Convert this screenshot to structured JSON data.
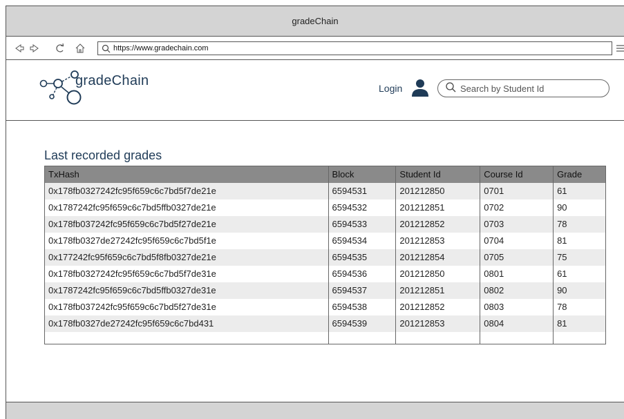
{
  "window": {
    "title": "gradeChain"
  },
  "browser": {
    "url": "https://www.gradechain.com",
    "icons": [
      "back-icon",
      "forward-icon",
      "refresh-icon",
      "home-icon",
      "search-icon",
      "menu-icon"
    ]
  },
  "header": {
    "logo_text": "gradeChain",
    "login_label": "Login",
    "search_placeholder": "Search by Student Id"
  },
  "main": {
    "section_title": "Last recorded grades",
    "columns": [
      "TxHash",
      "Block",
      "Student Id",
      "Course Id",
      "Grade"
    ],
    "rows": [
      [
        "0x178fb0327242fc95f659c6c7bd5f7de21e",
        "6594531",
        "201212850",
        "0701",
        "61"
      ],
      [
        "0x1787242fc95f659c6c7bd5ffb0327de21e",
        "6594532",
        "201212851",
        "0702",
        "90"
      ],
      [
        "0x178fb037242fc95f659c6c7bd5f27de21e",
        "6594533",
        "201212852",
        "0703",
        "78"
      ],
      [
        "0x178fb0327de27242fc95f659c6c7bd5f1e",
        "6594534",
        "201212853",
        "0704",
        "81"
      ],
      [
        "0x177242fc95f659c6c7bd5f8fb0327de21e",
        "6594535",
        "201212854",
        "0705",
        "75"
      ],
      [
        "0x178fb0327242fc95f659c6c7bd5f7de31e",
        "6594536",
        "201212850",
        "0801",
        "61"
      ],
      [
        "0x1787242fc95f659c6c7bd5ffb0327de31e",
        "6594537",
        "201212851",
        "0802",
        "90"
      ],
      [
        "0x178fb037242fc95f659c6c7bd5f27de31e",
        "6594538",
        "201212852",
        "0803",
        "78"
      ],
      [
        "0x178fb0327de27242fc95f659c6c7bd431",
        "6594539",
        "201212853",
        "0804",
        "81"
      ]
    ]
  },
  "colors": {
    "accent": "#1f3b57",
    "header_row": "#8a8a8a",
    "alt_row": "#ececec",
    "chrome": "#d4d4d4"
  }
}
